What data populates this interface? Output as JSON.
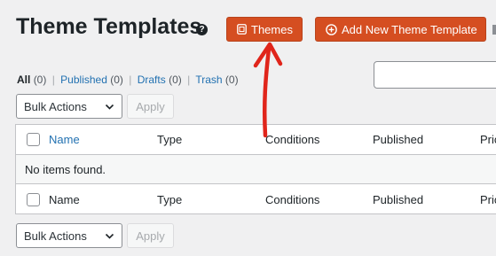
{
  "header": {
    "title": "Theme Templates",
    "help_icon": "?",
    "themes_button": "Themes",
    "add_button": "Add New Theme Template"
  },
  "views": {
    "all_label": "All",
    "all_count": "(0)",
    "published_label": "Published",
    "published_count": "(0)",
    "drafts_label": "Drafts",
    "drafts_count": "(0)",
    "trash_label": "Trash",
    "trash_count": "(0)",
    "separator": "|"
  },
  "bulk": {
    "select_value": "Bulk Actions",
    "apply_label": "Apply"
  },
  "table": {
    "columns": [
      "Name",
      "Type",
      "Conditions",
      "Published",
      "Prio"
    ],
    "empty_message": "No items found."
  },
  "colors": {
    "accent": "#d54e21",
    "link": "#2271b1",
    "annotation_arrow": "#e0251b"
  },
  "icons": {
    "themes": "template-icon",
    "add": "plus-circle-icon",
    "help": "question-circle-icon",
    "select": "chevron-down-icon"
  }
}
